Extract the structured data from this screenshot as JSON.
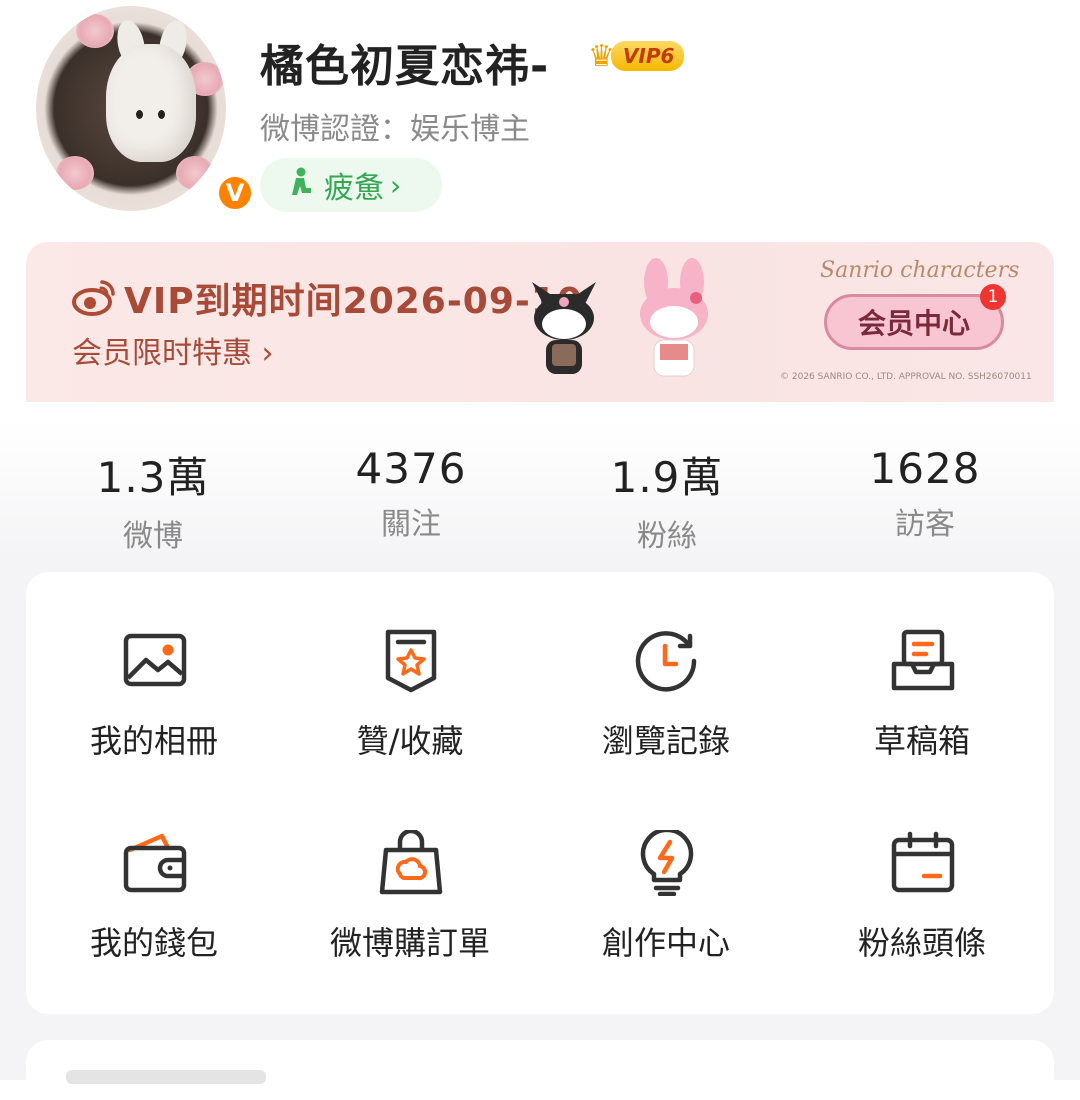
{
  "profile": {
    "username": "橘色初夏恋祎-",
    "vip_level": "VIP6",
    "certification": "微博認證：娱乐博主",
    "verified_mark": "V",
    "status": "疲惫",
    "status_chevron": "›"
  },
  "vip_banner": {
    "title": "VIP到期时间2026-09-10",
    "subtitle": "会员限时特惠 ›",
    "brand": "Sanrio characters",
    "member_button": "会员中心",
    "member_badge_count": "1",
    "copyright": "© 2026 SANRIO CO., LTD.  APPROVAL NO. SSH26070011"
  },
  "stats": [
    {
      "value": "1.3萬",
      "label": "微博"
    },
    {
      "value": "4376",
      "label": "關注"
    },
    {
      "value": "1.9萬",
      "label": "粉絲"
    },
    {
      "value": "1628",
      "label": "訪客"
    }
  ],
  "grid": [
    {
      "label": "我的相冊",
      "icon": "photo-album-icon"
    },
    {
      "label": "贊/收藏",
      "icon": "like-favorite-icon"
    },
    {
      "label": "瀏覽記錄",
      "icon": "history-icon"
    },
    {
      "label": "草稿箱",
      "icon": "drafts-icon"
    },
    {
      "label": "我的錢包",
      "icon": "wallet-icon"
    },
    {
      "label": "微博購訂單",
      "icon": "shopping-bag-icon"
    },
    {
      "label": "創作中心",
      "icon": "lightbulb-icon"
    },
    {
      "label": "粉絲頭條",
      "icon": "calendar-icon"
    }
  ],
  "colors": {
    "accent": "#ff8200",
    "icon_stroke": "#333333",
    "status_green": "#33a852",
    "banner_text": "#a84a38"
  }
}
